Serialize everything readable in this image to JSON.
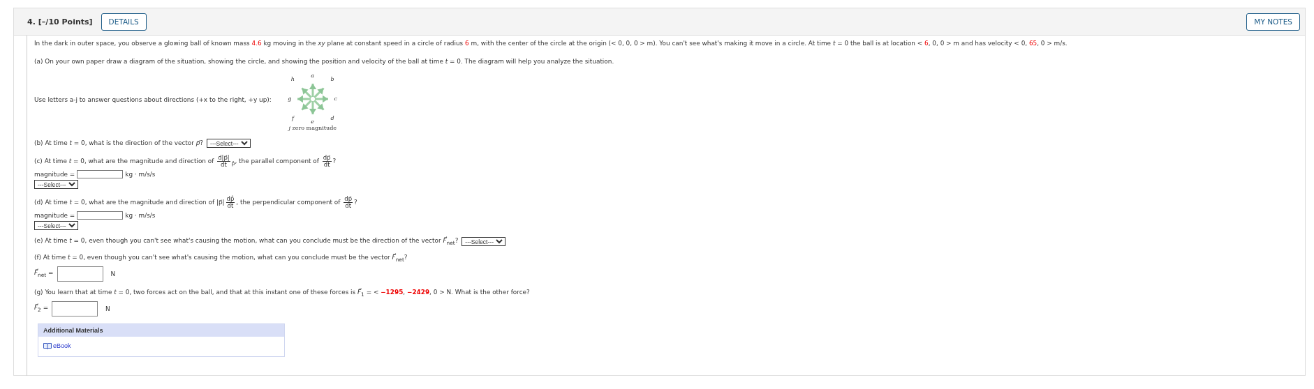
{
  "question": {
    "number": "4.",
    "points": "[–/10 Points]",
    "details": "DETAILS",
    "my_notes": "MY NOTES"
  },
  "intro": [
    {
      "kind": "text",
      "text": "In the dark in outer space, you observe a glowing ball of known mass "
    },
    {
      "kind": "red",
      "text": "4.6"
    },
    {
      "kind": "text",
      "text": " kg moving in the *xy* plane at constant speed in a circle of radius "
    },
    {
      "kind": "red",
      "text": "6"
    },
    {
      "kind": "text",
      "text": " m, with the center of the circle at the origin (< 0, 0, 0 > m). You can't see what's making it move in a circle. At time *t* = 0 the ball is at location < "
    },
    {
      "kind": "red",
      "text": "6"
    },
    {
      "kind": "text",
      "text": ", 0, 0 > m and has velocity < 0, "
    },
    {
      "kind": "red",
      "text": "65"
    },
    {
      "kind": "text",
      "text": ", 0 > m/s."
    }
  ],
  "part_a": [
    {
      "kind": "text",
      "text": "(a) On your own paper draw a diagram of the situation, showing the circle, and showing the position and velocity of the ball at time *t* = 0. The diagram will help you analyze the situation."
    }
  ],
  "directions": {
    "prompt": "Use letters a-j to answer questions about directions (+x to the right, +y up):",
    "letters": [
      "a",
      "b",
      "c",
      "d",
      "e",
      "f",
      "g",
      "h"
    ],
    "caption": "*j* zero magnitude"
  },
  "items": [
    {
      "prompt": [
        {
          "kind": "text",
          "text": "(b) At time *t* = 0, what is the direction of the vector *p⃗*?"
        }
      ],
      "inline_select": "---Select---"
    },
    {
      "prompt": [
        {
          "kind": "text",
          "text": "(c) At time *t* = 0, what are the magnitude and direction of "
        },
        {
          "kind": "frac",
          "num": "d|p⃗|",
          "den": "dt"
        },
        {
          "kind": "text",
          "text": "$_{p̂}$, the parallel component of "
        },
        {
          "kind": "frac",
          "num": "dp⃗",
          "den": "dt"
        },
        {
          "kind": "text",
          "text": "?"
        }
      ],
      "magnitude": {
        "label": "magnitude =",
        "unit": "kg · m/s/s"
      },
      "select": "---Select---"
    },
    {
      "prompt": [
        {
          "kind": "text",
          "text": "(d) At time *t* = 0, what are the magnitude and direction of |p⃗|"
        },
        {
          "kind": "frac",
          "num": "dp̂",
          "den": "dt"
        },
        {
          "kind": "text",
          "text": ", the perpendicular component of "
        },
        {
          "kind": "frac",
          "num": "dp⃗",
          "den": "dt"
        },
        {
          "kind": "text",
          "text": "?"
        }
      ],
      "magnitude": {
        "label": "magnitude =",
        "unit": "kg · m/s/s"
      },
      "select": "---Select---"
    },
    {
      "prompt": [
        {
          "kind": "text",
          "text": "(e) At time *t* = 0, even though you can't see what's causing the motion, what can you conclude must be the direction of the vector *F⃗*$_{net}$?"
        }
      ],
      "inline_select": "---Select---"
    },
    {
      "prompt": [
        {
          "kind": "text",
          "text": "(f) At time *t* = 0, even though you can't see what's causing the motion, what can you conclude must be the vector *F⃗*$_{net}$?"
        }
      ],
      "vector": {
        "label": "*F⃗*$_{net}$ =",
        "unit": "N"
      }
    },
    {
      "prompt": [
        {
          "kind": "text",
          "text": "(g) You learn that at time *t* = 0, two forces act on the ball, and that at this instant one of these forces is *F⃗*$_{1}$ = < "
        },
        {
          "kind": "red",
          "text": "−1295"
        },
        {
          "kind": "text",
          "text": ", "
        },
        {
          "kind": "red",
          "text": "−2429"
        },
        {
          "kind": "text",
          "text": ", 0 > N. What is the other force?"
        }
      ],
      "vector": {
        "label": "*F⃗*$_{2}$ =",
        "unit": "N"
      }
    }
  ],
  "materials": {
    "title": "Additional Materials",
    "link": "eBook"
  }
}
